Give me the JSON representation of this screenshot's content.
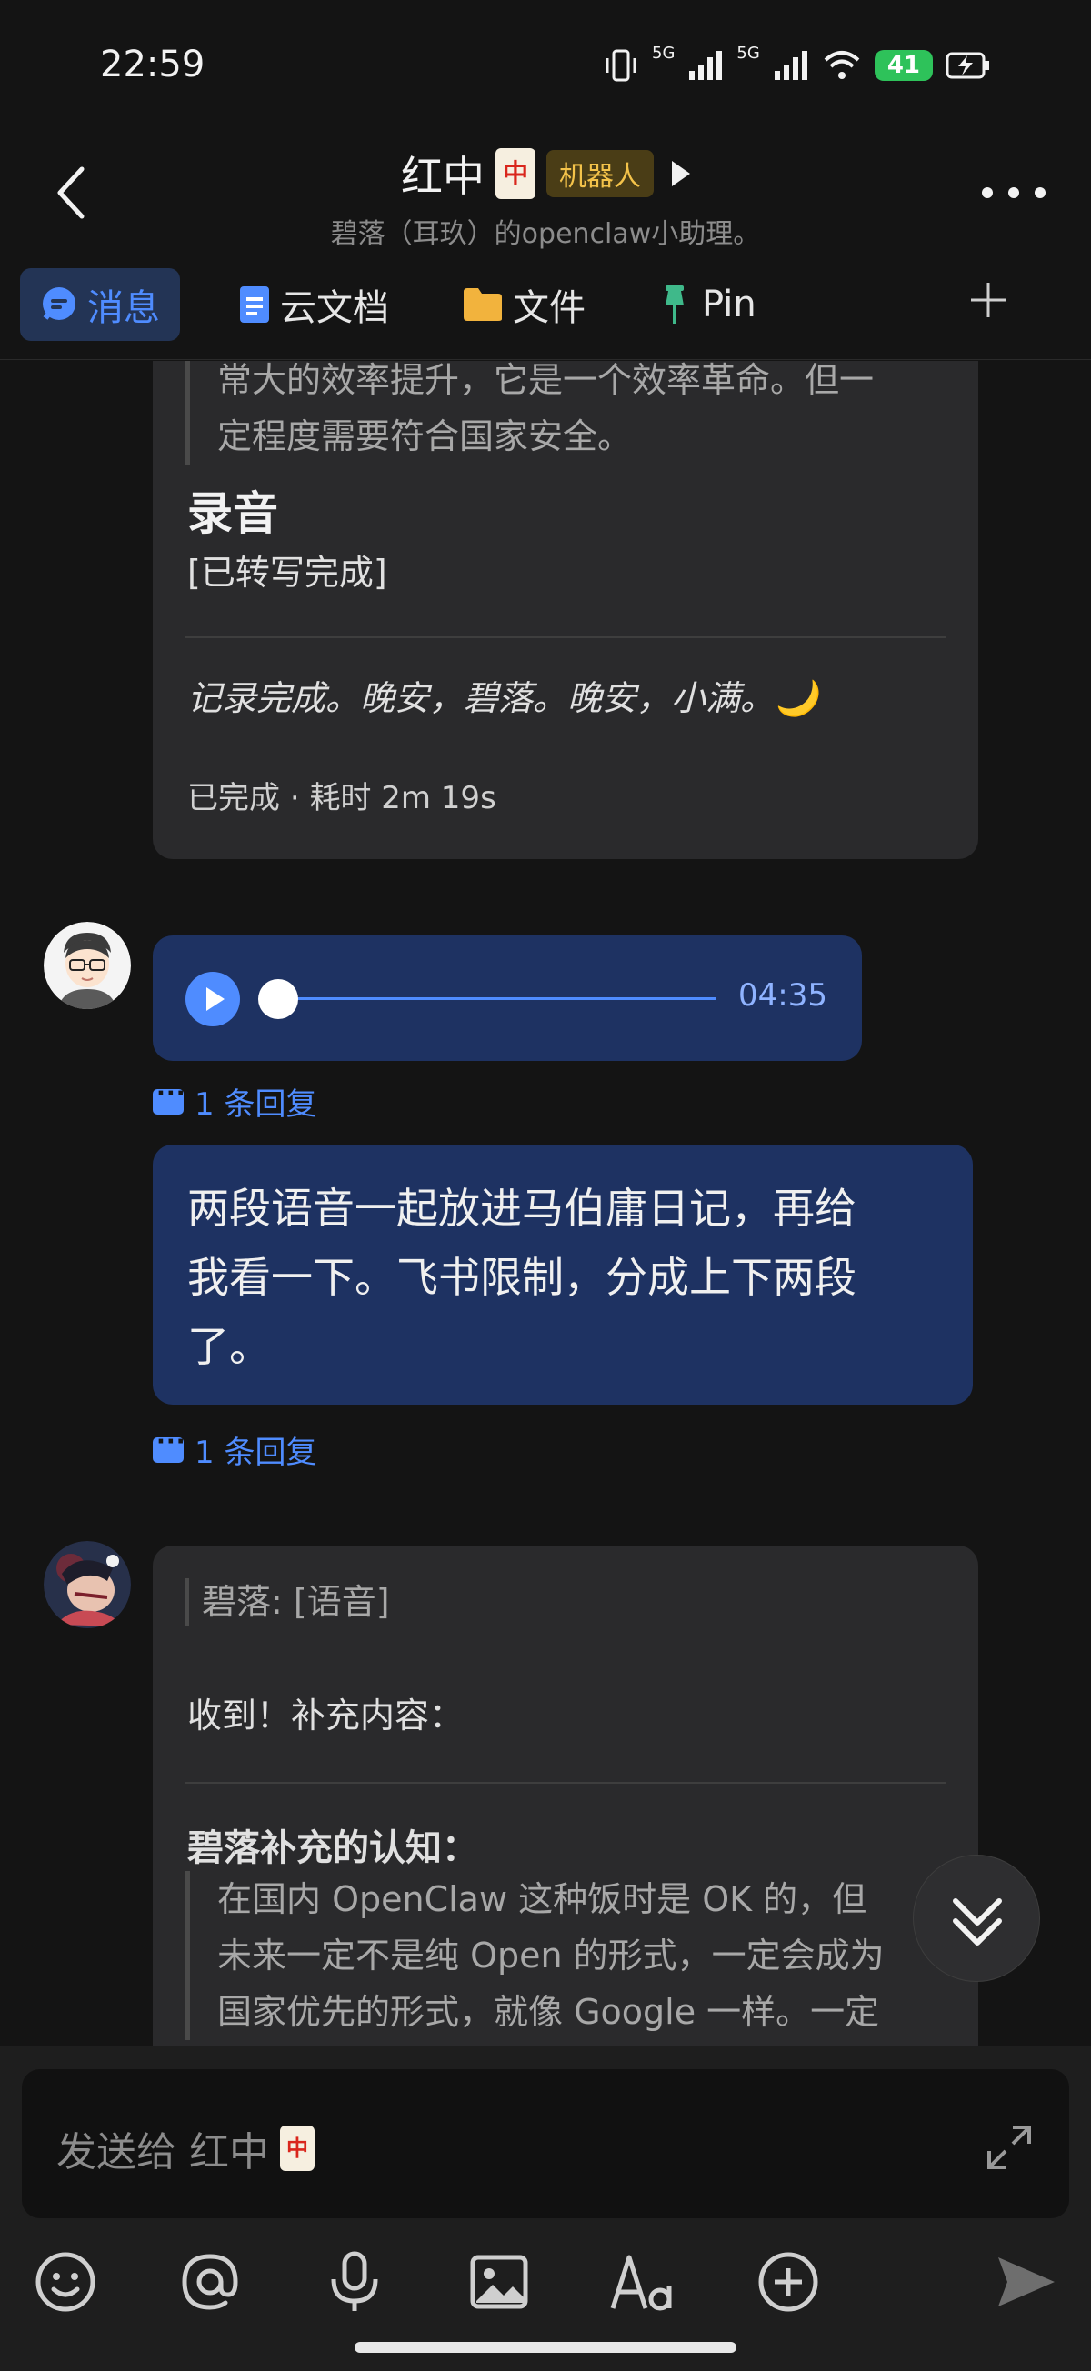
{
  "status": {
    "time": "22:59",
    "network_1": "5G",
    "network_2": "5G",
    "battery": "41"
  },
  "header": {
    "title": "红中",
    "title_tile": "中",
    "badge": "机器人",
    "subtitle": "碧落（耳玖）的openclaw小助理。"
  },
  "tabs": [
    {
      "label": "消息",
      "icon": "chat-icon"
    },
    {
      "label": "云文档",
      "icon": "doc-icon"
    },
    {
      "label": "文件",
      "icon": "folder-icon"
    },
    {
      "label": "Pin",
      "icon": "pin-icon"
    }
  ],
  "messages": {
    "card1": {
      "quote_line1": "常大的效率提升，它是一个效率革命。但一",
      "quote_line2": "定程度需要符合国家安全。",
      "heading": "录音",
      "transcribed": "[已转写完成]",
      "closing": "记录完成。晚安，碧落。晚安，小满。🌙",
      "status": "已完成",
      "duration": "耗时 2m 19s"
    },
    "voice": {
      "time": "04:35",
      "progress": 0
    },
    "reply_count_1": "1 条回复",
    "user_text_line1": "两段语音一起放进马伯庸日记，再给",
    "user_text_line2": "我看一下。飞书限制，分成上下两段",
    "user_text_line3": "了。",
    "reply_count_2": "1 条回复",
    "card2": {
      "quote_ref": "碧落: [语音]",
      "received": "收到！补充内容：",
      "heading": "碧落补充的认知：",
      "quote_line1": "在国内 OpenClaw 这种饭时是 OK 的，但",
      "quote_line2": "未来一定不是纯 Open 的形式，一定会成为",
      "quote_line3": "国家优先的形式，就像 Google 一样。一定"
    }
  },
  "input": {
    "placeholder": "发送给 红中",
    "tile": "中"
  },
  "colors": {
    "accent": "#4f8cff",
    "bubble_blue": "#1e3262",
    "card_bg": "#2a2a2c",
    "bot_badge": "#f4c34a"
  }
}
